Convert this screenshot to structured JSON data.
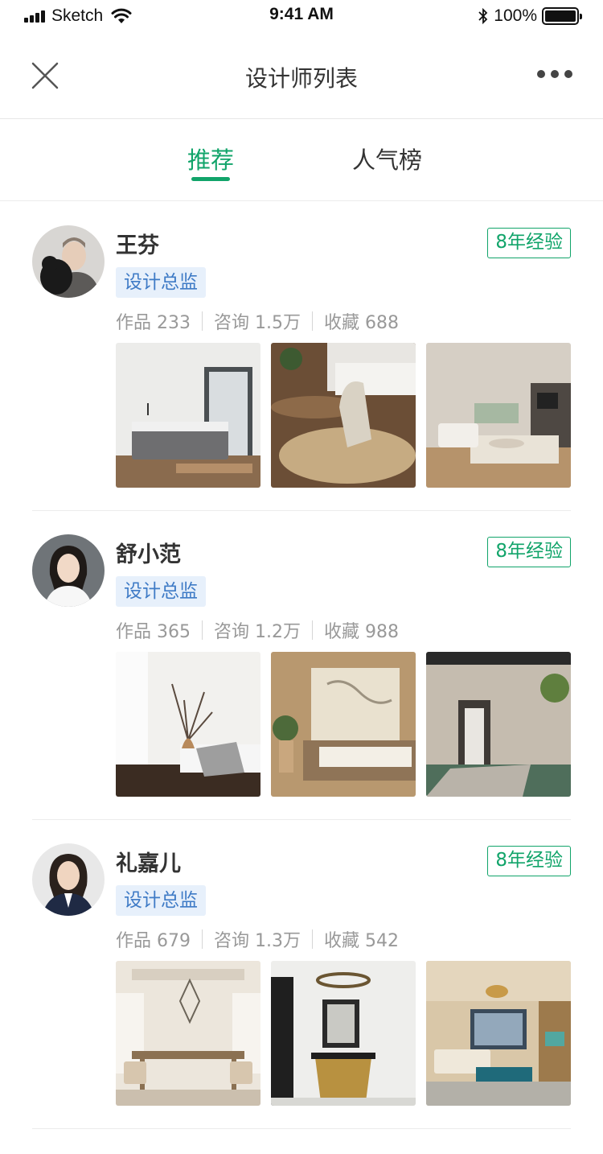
{
  "status_bar": {
    "carrier": "Sketch",
    "time": "9:41 AM",
    "battery": "100%"
  },
  "nav": {
    "title": "设计师列表"
  },
  "tabs": [
    {
      "label": "推荐",
      "active": true
    },
    {
      "label": "人气榜",
      "active": false
    }
  ],
  "colors": {
    "accent": "#11a46a",
    "tag_bg": "#e7f0fb",
    "tag_text": "#3f7bc6"
  },
  "designers": [
    {
      "name": "王芬",
      "role": "设计总监",
      "experience": "8年经验",
      "stats": {
        "works": "作品 233",
        "consults": "咨询 1.5万",
        "favorites": "收藏 688"
      }
    },
    {
      "name": "舒小范",
      "role": "设计总监",
      "experience": "8年经验",
      "stats": {
        "works": "作品 365",
        "consults": "咨询 1.2万",
        "favorites": "收藏 988"
      }
    },
    {
      "name": "礼嘉儿",
      "role": "设计总监",
      "experience": "8年经验",
      "stats": {
        "works": "作品 679",
        "consults": "咨询 1.3万",
        "favorites": "收藏 542"
      }
    }
  ]
}
